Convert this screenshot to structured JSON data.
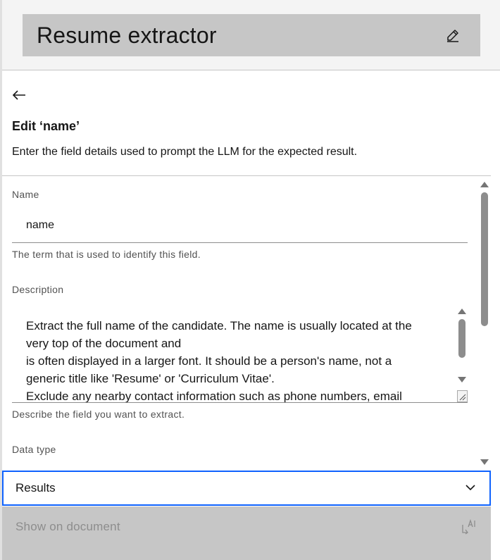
{
  "header": {
    "title": "Resume extractor",
    "edit_icon": "pencil-icon"
  },
  "panel": {
    "back_icon": "arrow-left-icon",
    "heading": "Edit ‘name’",
    "subtext": "Enter the field details used to prompt the LLM for the expected result."
  },
  "form": {
    "name": {
      "label": "Name",
      "value": "name",
      "helper": "The term that is used to identify this field."
    },
    "description": {
      "label": "Description",
      "lines": [
        "Extract the full name of the candidate. The name is usually located at the",
        "very top of the document and",
        "is often displayed in a larger font. It should be a person's name, not a",
        "generic title like 'Resume' or 'Curriculum Vitae'.",
        "Exclude any nearby contact information such as phone numbers, email"
      ],
      "helper": "Describe the field you want to extract."
    },
    "data_type": {
      "label": "Data type"
    }
  },
  "results_select": {
    "label": "Results",
    "icon": "chevron-down-icon"
  },
  "footer": {
    "show_on_document": "Show on document",
    "icon": "ai-label-icon"
  },
  "colors": {
    "focus_border": "#0f62fe",
    "title_bar_bg": "#c6c6c6",
    "footer_bg": "#c6c6c6",
    "disabled_text": "#8d8d8d"
  }
}
